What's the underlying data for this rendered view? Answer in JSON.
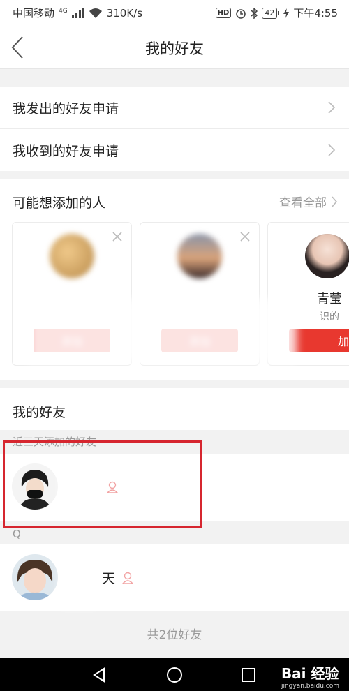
{
  "status_bar": {
    "carrier": "中国移动",
    "network": "4G",
    "speed": "310K/s",
    "hd": "HD",
    "battery": "42",
    "time": "下午4:55"
  },
  "header": {
    "title": "我的好友"
  },
  "menu": [
    {
      "label": "我发出的好友申请"
    },
    {
      "label": "我收到的好友申请"
    }
  ],
  "suggestions": {
    "title": "可能想添加的人",
    "see_all": "查看全部",
    "cards": [
      {
        "name": "",
        "sub": "",
        "add_label": "添加"
      },
      {
        "name": "",
        "sub": "",
        "add_label": "添加"
      },
      {
        "name": "青莹",
        "sub": "识的",
        "add_label": "加"
      }
    ]
  },
  "friends": {
    "title": "我的好友",
    "groups": [
      {
        "label": "近三天添加的好友",
        "items": [
          {
            "name": ""
          }
        ]
      },
      {
        "label": "Q",
        "items": [
          {
            "name": "天"
          }
        ]
      }
    ],
    "total": "共2位好友"
  },
  "colors": {
    "accent": "#e8382f",
    "highlight": "#d6262f"
  },
  "watermark": {
    "brand": "Bai 经验",
    "url": "jingyan.baidu.com"
  }
}
